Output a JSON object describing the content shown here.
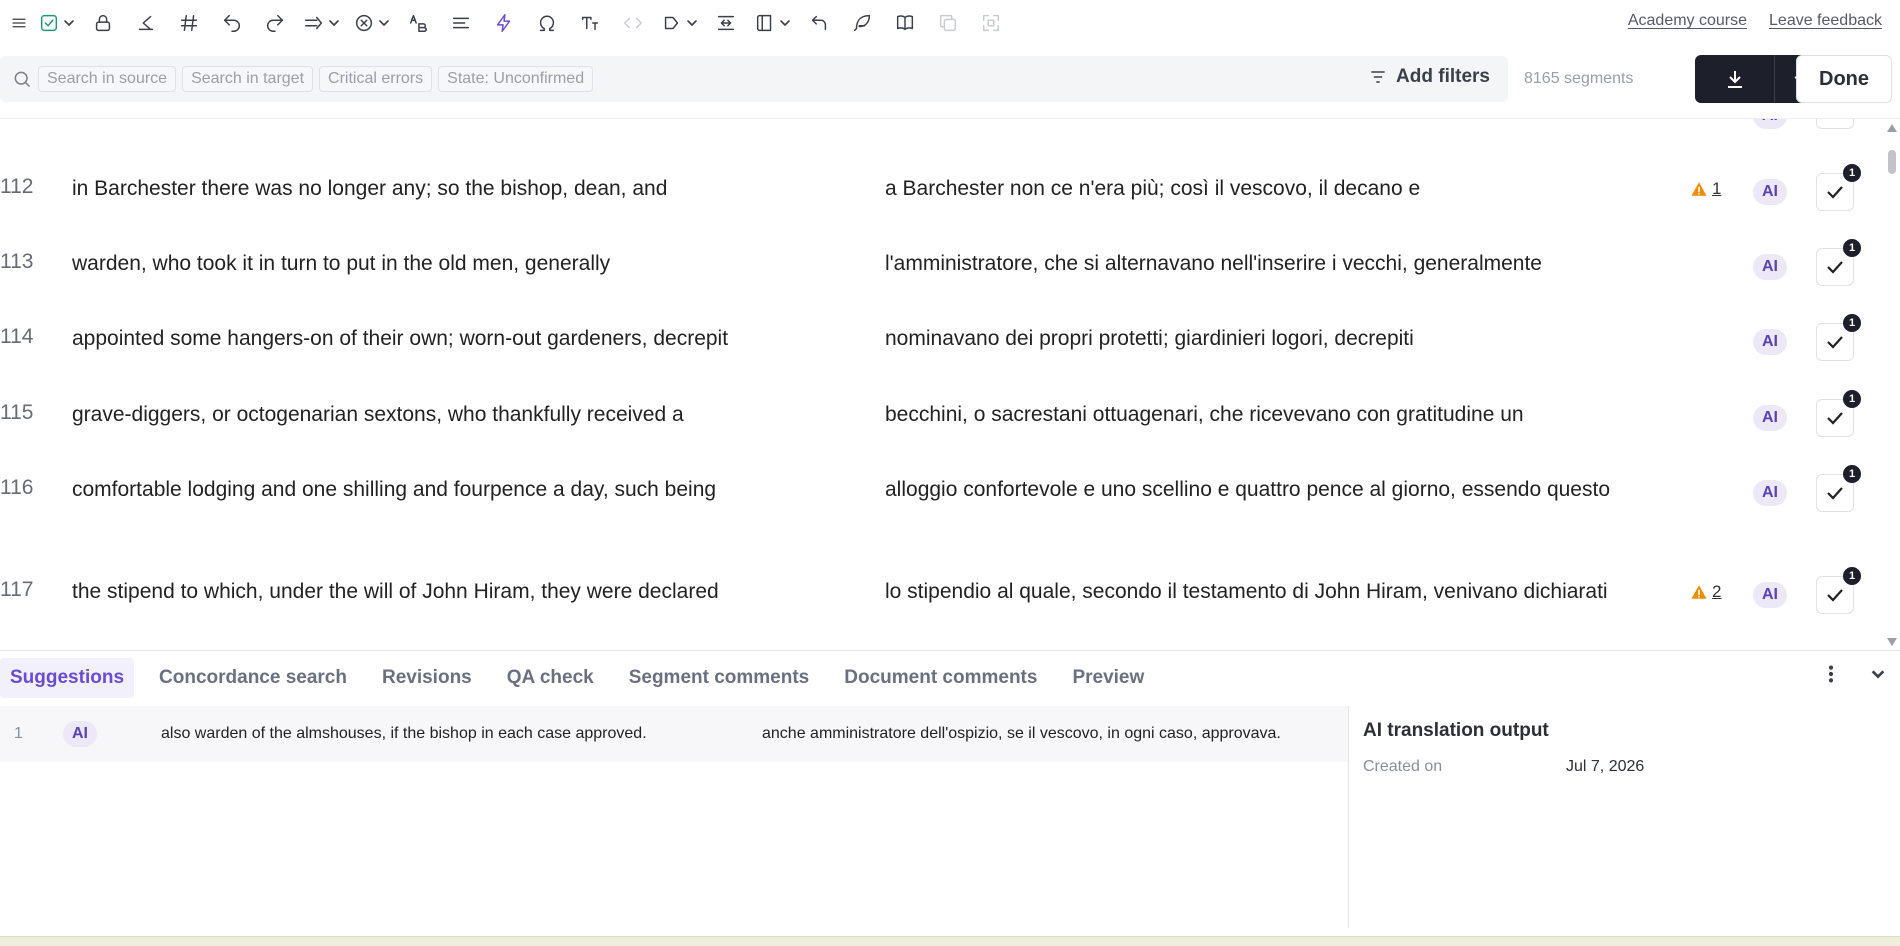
{
  "toolbar": {
    "links": {
      "academy": "Academy course",
      "feedback": "Leave feedback"
    }
  },
  "filters": {
    "chips": [
      "Search in source",
      "Search in target",
      "Critical errors",
      "State: Unconfirmed"
    ],
    "add_filters": "Add filters",
    "segment_count": "8165 segments",
    "done": "Done"
  },
  "segments": [
    {
      "num": "112",
      "source": "in Barchester there was no longer any; so the bishop, dean, and",
      "target": "a Barchester non ce n'era più; così il vescovo, il decano e",
      "warning": "1",
      "ai": "AI",
      "confirm_count": "1"
    },
    {
      "num": "113",
      "source": "warden, who took it in turn to put in the old men, generally",
      "target": "l'amministratore, che si alternavano nell'inserire i vecchi, generalmente",
      "warning": null,
      "ai": "AI",
      "confirm_count": "1"
    },
    {
      "num": "114",
      "source": "appointed some hangers-on of their own; worn-out gardeners, decrepit",
      "target": "nominavano dei propri protetti; giardinieri logori, decrepiti",
      "warning": null,
      "ai": "AI",
      "confirm_count": "1"
    },
    {
      "num": "115",
      "source": "grave-diggers, or octogenarian sextons, who thankfully received a",
      "target": "becchini, o sacrestani ottuagenari, che ricevevano con gratitudine un",
      "warning": null,
      "ai": "AI",
      "confirm_count": "1"
    },
    {
      "num": "116",
      "source": "comfortable lodging and one shilling and fourpence a day, such being",
      "target": "alloggio confortevole e uno scellino e quattro pence al giorno, essendo questo",
      "warning": null,
      "ai": "AI",
      "confirm_count": "1"
    },
    {
      "num": "117",
      "source": "the stipend to which, under the will of John Hiram, they were declared",
      "target": "lo stipendio al quale, secondo il testamento di John Hiram, venivano dichiarati",
      "warning": "2",
      "ai": "AI",
      "confirm_count": "1"
    }
  ],
  "partial_row": {
    "ai": "AI"
  },
  "panel": {
    "tabs": [
      "Suggestions",
      "Concordance search",
      "Revisions",
      "QA check",
      "Segment comments",
      "Document comments",
      "Preview"
    ],
    "active_tab": 0,
    "suggestion": {
      "num": "1",
      "ai": "AI",
      "source": "also warden of the almshouses, if the bishop in each case approved.",
      "target": "anche amministratore dell'ospizio, se il vescovo, in ogni caso, approvava."
    },
    "info": {
      "title": "AI translation output",
      "created_label": "Created on",
      "created_value": "Jul 7, 2026"
    }
  },
  "colors": {
    "accent": "#6a4bd4",
    "warning": "#f08c00",
    "dark": "#1d1f2a"
  }
}
